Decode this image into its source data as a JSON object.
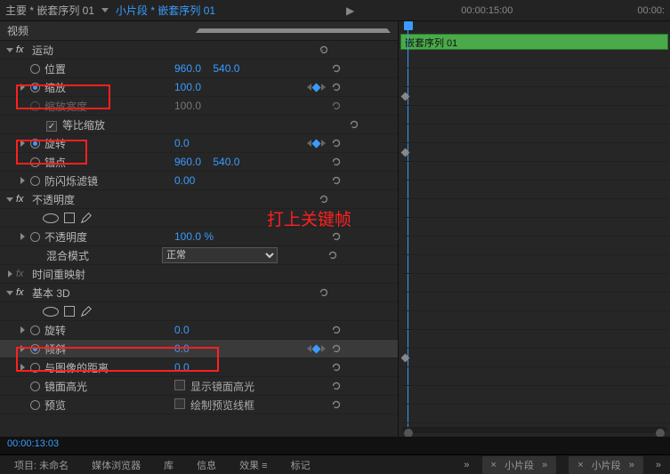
{
  "header": {
    "master_label": "主要 * 嵌套序列 01",
    "clip_label": "小片段 * 嵌套序列 01",
    "time_tick": "00:00:15:00",
    "time_tick2": "00:00:"
  },
  "video_section": "视频",
  "clip_bar": "嵌套序列 01",
  "effects": {
    "motion": {
      "name": "运动",
      "position": {
        "label": "位置",
        "x": "960.0",
        "y": "540.0"
      },
      "scale": {
        "label": "缩放",
        "value": "100.0"
      },
      "scale_width": {
        "label": "缩放宽度",
        "value": "100.0"
      },
      "uniform": {
        "label": "等比缩放"
      },
      "rotation": {
        "label": "旋转",
        "value": "0.0"
      },
      "anchor": {
        "label": "锚点",
        "x": "960.0",
        "y": "540.0"
      },
      "antiflicker": {
        "label": "防闪烁滤镜",
        "value": "0.00"
      }
    },
    "opacity": {
      "name": "不透明度",
      "opacity": {
        "label": "不透明度",
        "value": "100.0 %"
      },
      "blend": {
        "label": "混合模式",
        "value": "正常"
      }
    },
    "timeremap": {
      "name": "时间重映射"
    },
    "basic3d": {
      "name": "基本 3D",
      "swivel": {
        "label": "旋转",
        "value": "0.0"
      },
      "tilt": {
        "label": "倾斜",
        "value": "0.0"
      },
      "distance": {
        "label": "与图像的距离",
        "value": "0.0"
      },
      "specular": {
        "label": "镜面高光",
        "check": "显示镜面高光"
      },
      "preview": {
        "label": "预览",
        "check": "绘制预览线框"
      }
    }
  },
  "annotation": "打上关键帧",
  "timecode": "00:00:13:03",
  "tabs": {
    "project": "项目: 未命名",
    "media": "媒体浏览器",
    "library": "库",
    "info": "信息",
    "effects": "效果",
    "markers": "标记",
    "seq1": "小片段",
    "seq2": "小片段"
  }
}
